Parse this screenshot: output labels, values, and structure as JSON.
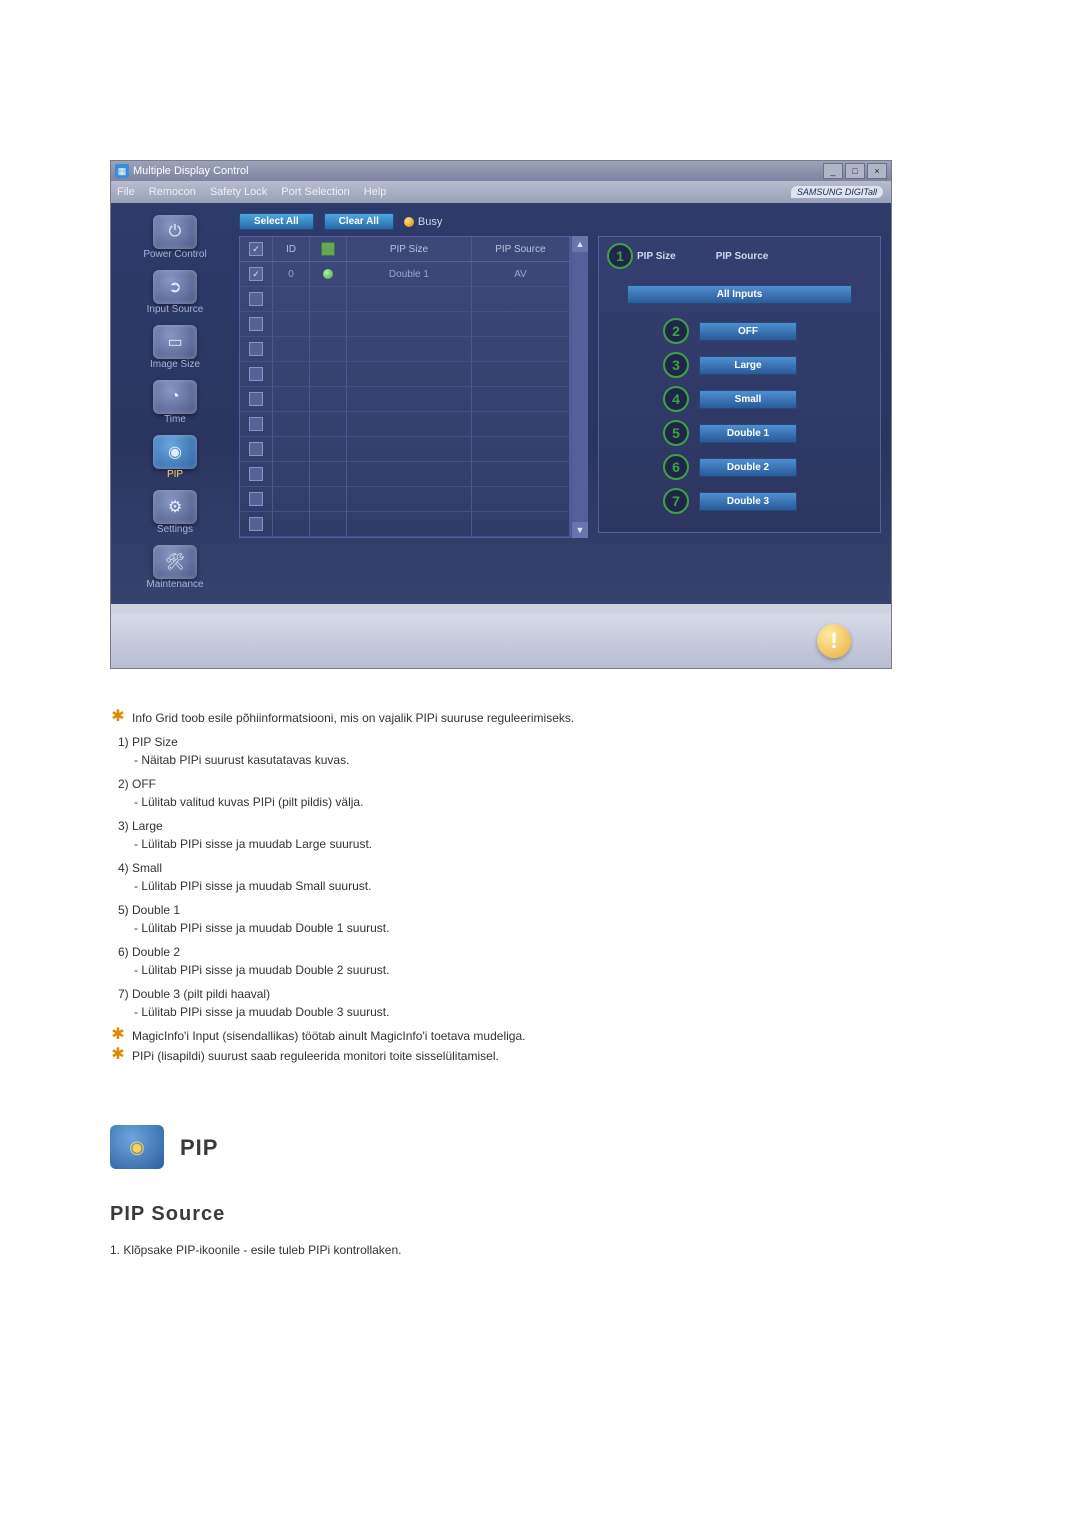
{
  "app": {
    "title": "Multiple Display Control",
    "brand": "SAMSUNG DIGITall"
  },
  "menubar": {
    "items": [
      "File",
      "Remocon",
      "Safety Lock",
      "Port Selection",
      "Help"
    ]
  },
  "sidebar": {
    "items": [
      {
        "label": "Power Control"
      },
      {
        "label": "Input Source"
      },
      {
        "label": "Image Size"
      },
      {
        "label": "Time"
      },
      {
        "label": "PIP"
      },
      {
        "label": "Settings"
      },
      {
        "label": "Maintenance"
      }
    ]
  },
  "toolbar": {
    "select_all": "Select All",
    "clear_all": "Clear All",
    "busy": "Busy"
  },
  "grid": {
    "headers": {
      "chk": "",
      "id": "ID",
      "status": "",
      "pip_size": "PIP Size",
      "pip_source": "PIP Source"
    },
    "row0": {
      "id": "0",
      "pip_size": "Double 1",
      "pip_source": "AV"
    }
  },
  "right_panel": {
    "head_size": "PIP Size",
    "head_source": "PIP Source",
    "all_inputs": "All Inputs",
    "options": {
      "off": "OFF",
      "large": "Large",
      "small": "Small",
      "double1": "Double 1",
      "double2": "Double 2",
      "double3": "Double 3"
    },
    "badges": {
      "b1": "1",
      "b2": "2",
      "b3": "3",
      "b4": "4",
      "b5": "5",
      "b6": "6",
      "b7": "7"
    }
  },
  "doc": {
    "star1": "Info Grid toob esile põhiinformatsiooni, mis on vajalik PIPi suuruse reguleerimiseks.",
    "n1_t": "1)  PIP Size",
    "n1_s": "- Näitab PIPi suurust kasutatavas kuvas.",
    "n2_t": "2)  OFF",
    "n2_s": "- Lülitab valitud kuvas PIPi (pilt pildis) välja.",
    "n3_t": "3)  Large",
    "n3_s": "- Lülitab PIPi sisse ja muudab Large suurust.",
    "n4_t": "4)  Small",
    "n4_s": "- Lülitab PIPi sisse ja muudab Small suurust.",
    "n5_t": "5)  Double 1",
    "n5_s": "- Lülitab PIPi sisse ja muudab Double 1 suurust.",
    "n6_t": "6)  Double 2",
    "n6_s": "- Lülitab PIPi sisse ja muudab Double 2 suurust.",
    "n7_t": "7)  Double 3 (pilt pildi haaval)",
    "n7_s": "- Lülitab PIPi sisse ja muudab Double 3 suurust.",
    "star2": "MagicInfo'i Input (sisendallikas) töötab ainult MagicInfo'i toetava mudeliga.",
    "star3": "PIPi (lisapildi) suurust saab reguleerida monitori toite sisselülitamisel.",
    "section_pip": "PIP",
    "sub_pip_source": "PIP Source",
    "step1": "1.  Klõpsake PIP-ikoonile - esile tuleb PIPi kontrollaken."
  }
}
